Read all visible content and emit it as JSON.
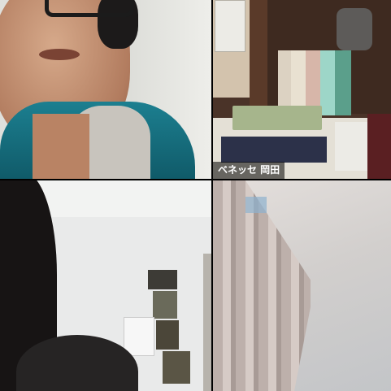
{
  "participants": [
    {
      "label": ""
    },
    {
      "label": "ベネッセ 岡田"
    },
    {
      "label": ""
    },
    {
      "label": ""
    }
  ]
}
